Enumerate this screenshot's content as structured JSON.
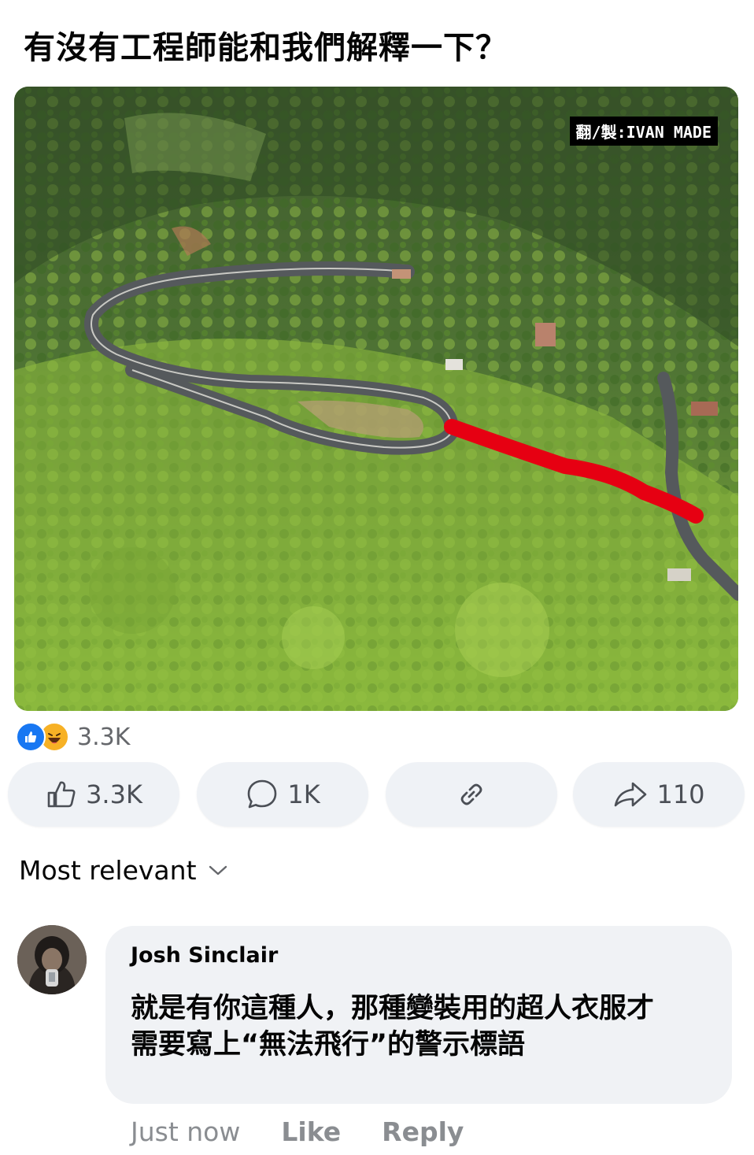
{
  "post": {
    "title": "有沒有工程師能和我們解釋一下？",
    "watermark": "翻/製:IVAN MADE"
  },
  "reactions": {
    "icons": [
      "like-icon",
      "haha-icon"
    ],
    "count": "3.3K"
  },
  "actions": {
    "like_count": "3.3K",
    "comment_count": "1K",
    "share_count": "110"
  },
  "comments_section": {
    "sort_label": "Most relevant"
  },
  "comment": {
    "author": "Josh Sinclair",
    "text_line1": "就是有你這種人，那種變裝用的超人衣服才",
    "text_line2": "需要寫上“無法飛行”的警示標語",
    "time": "Just now",
    "like_label": "Like",
    "reply_label": "Reply"
  },
  "colors": {
    "accent_blue": "#1877f2",
    "button_bg": "#eff2f6",
    "bubble_bg": "#f0f2f5",
    "muted_text": "#65676b",
    "highlight_red": "#e60012"
  }
}
